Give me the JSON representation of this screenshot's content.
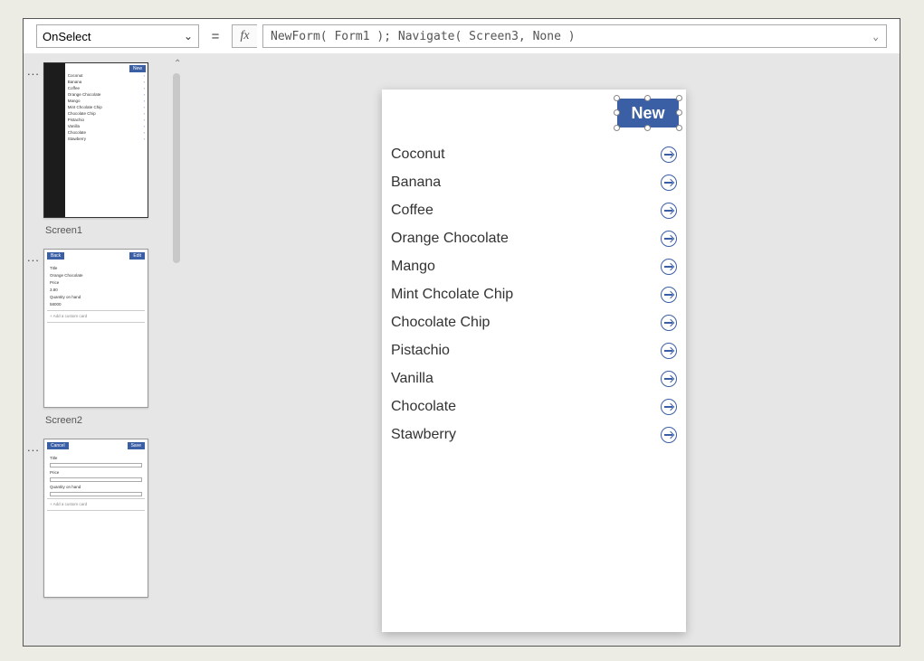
{
  "formula_bar": {
    "property": "OnSelect",
    "fx_label": "fx",
    "formula": "NewForm( Form1 ); Navigate( Screen3, None )"
  },
  "screens": {
    "s1_label": "Screen1",
    "s2_label": "Screen2",
    "s1_new": "New",
    "s2_back": "Back",
    "s2_edit": "Edit",
    "s3_cancel": "Cancel",
    "s3_save": "Save",
    "form_title_lbl": "Title",
    "form_title_val": "Orange Chocolate",
    "form_price_lbl": "Price",
    "form_price_val": "3.80",
    "form_qty_lbl": "Quantity on hand",
    "form_qty_val": "58000",
    "form_addcard": "+  Add a custom card"
  },
  "app": {
    "new_label": "New",
    "items": [
      "Coconut",
      "Banana",
      "Coffee",
      "Orange Chocolate",
      "Mango",
      "Mint Chcolate Chip",
      "Chocolate Chip",
      "Pistachio",
      "Vanilla",
      "Chocolate",
      "Stawberry"
    ]
  }
}
